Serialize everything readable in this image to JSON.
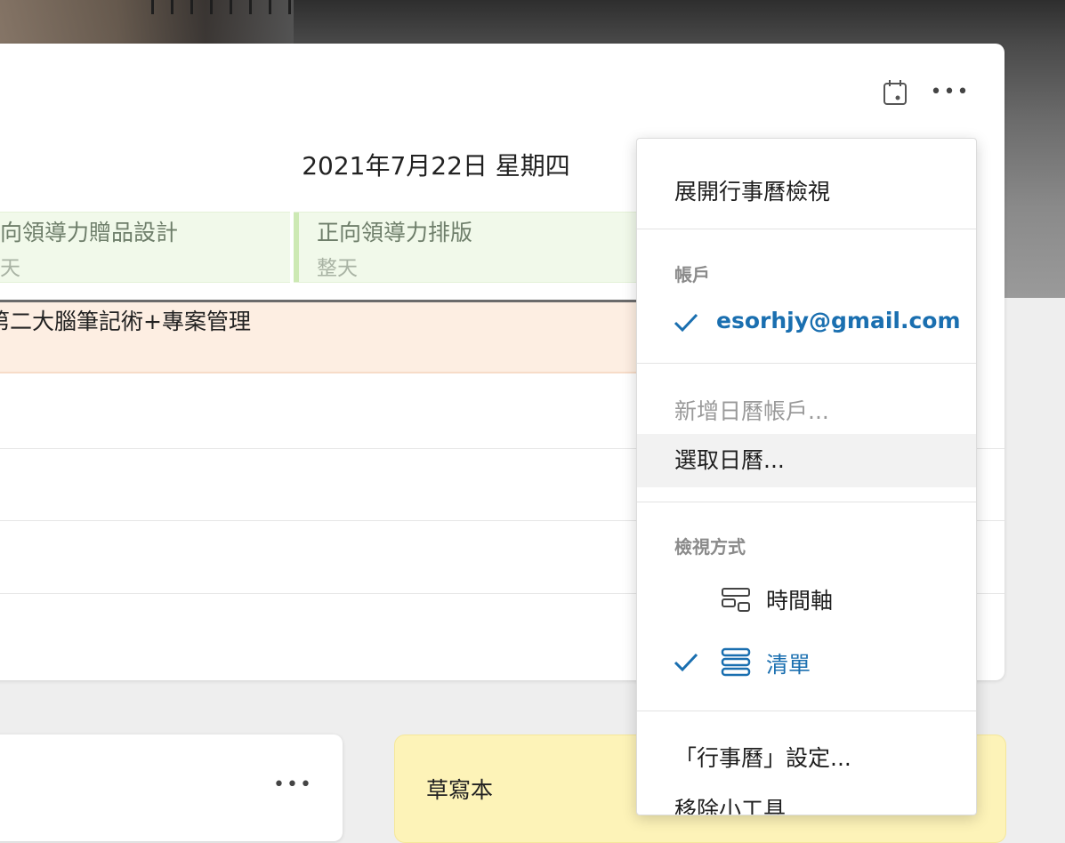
{
  "calendar": {
    "date_title": "2021年7月22日 星期四",
    "allday_events": [
      {
        "title": "向領導力贈品設計",
        "subtitle": "天"
      },
      {
        "title": "正向領導力排版",
        "subtitle": "整天"
      }
    ],
    "timed_event": {
      "title": "第二大腦筆記術+專案管理"
    },
    "toolbar": {
      "date_icon": "calendar-day-icon",
      "more_icon": "more-icon"
    }
  },
  "menu": {
    "expand_view": "展開行事曆檢視",
    "account_section": "帳戶",
    "account_email": "esorhjy@gmail.com",
    "add_account": "新增日曆帳戶...",
    "choose_calendar": "選取日曆...",
    "view_section": "檢視方式",
    "view_timeline": "時間軸",
    "view_list": "清單",
    "settings": "「行事曆」設定...",
    "remove_widget": "移除小工具"
  },
  "notes": {
    "sticky_title": "草寫本",
    "more_icon": "more-icon"
  },
  "colors": {
    "accent": "#1a6fb0",
    "allday_event_bg": "#f1f9ea",
    "timed_event_bg": "#fdeee2",
    "sticky_bg": "#fdf3b8"
  }
}
